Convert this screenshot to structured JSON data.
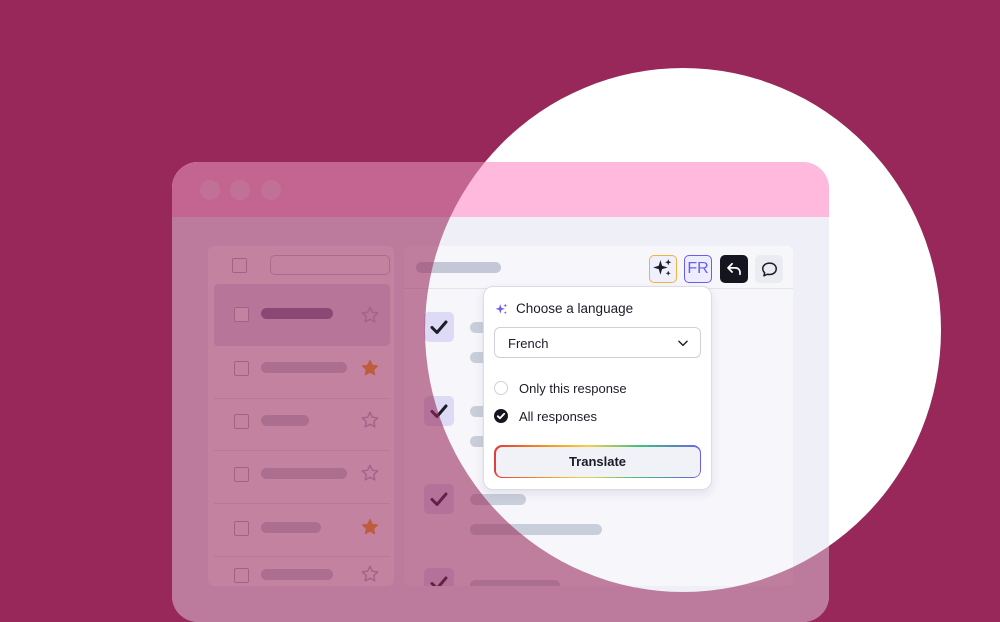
{
  "toolbar": {
    "language_code": "FR"
  },
  "translate_popup": {
    "title": "Choose a language",
    "selected_language": "French",
    "options": [
      {
        "label": "Only this response",
        "checked": false
      },
      {
        "label": "All responses",
        "checked": true
      }
    ],
    "translate_label": "Translate"
  },
  "inbox": {
    "rows": [
      {
        "selected": true,
        "starred": false
      },
      {
        "selected": false,
        "starred": true
      },
      {
        "selected": false,
        "starred": false
      },
      {
        "selected": false,
        "starred": false
      },
      {
        "selected": false,
        "starred": true
      },
      {
        "selected": false,
        "starred": false
      }
    ]
  },
  "colors": {
    "background": "#98285a",
    "accent": "#6a5cf0",
    "star": "#f0a818",
    "check_dark": "#15151f"
  }
}
